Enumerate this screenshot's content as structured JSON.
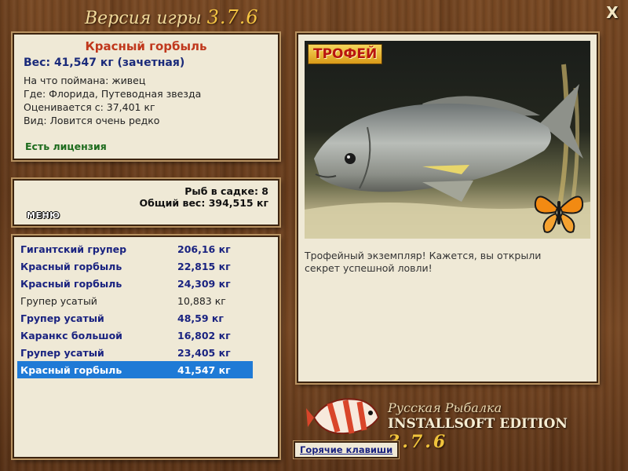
{
  "window": {
    "title_prefix": "Версия игры",
    "title_version": "3.7.6",
    "close_label": "X"
  },
  "fish_info": {
    "name": "Красный горбыль",
    "weight": "Вес: 41,547 кг (зачетная)",
    "bait": "На что поймана: живец",
    "location": "Где: Флорида, Путеводная звезда",
    "value": "Оценивается с: 37,401 кг",
    "species_note": "Вид: Ловится очень редко",
    "license": "Есть лицензия"
  },
  "stats": {
    "menu_label": "МЕНЮ",
    "fish_count": "Рыб в садке: 8",
    "total_weight": "Общий вес: 394,515 кг"
  },
  "catches": [
    {
      "name": "Гигантский групер",
      "weight": "206,16 кг",
      "style": "bold"
    },
    {
      "name": "Красный горбыль",
      "weight": "22,815 кг",
      "style": "bold"
    },
    {
      "name": "Красный горбыль",
      "weight": "24,309 кг",
      "style": "bold"
    },
    {
      "name": "Групер усатый",
      "weight": "10,883 кг",
      "style": "plain"
    },
    {
      "name": "Групер усатый",
      "weight": "48,59 кг",
      "style": "bold"
    },
    {
      "name": "Каранкс большой",
      "weight": "16,802 кг",
      "style": "bold"
    },
    {
      "name": "Групер усатый",
      "weight": "23,405 кг",
      "style": "bold"
    },
    {
      "name": "Красный горбыль",
      "weight": "41,547 кг",
      "style": "selected"
    }
  ],
  "trophy": {
    "badge": "ТРОФЕЙ",
    "caption": "Трофейный экземпляр! Кажется, вы открыли секрет успешной ловли!"
  },
  "branding": {
    "line1": "Русская Рыбалка",
    "line2": "INSTALLSOFT EDITION",
    "version": "3.7.6"
  },
  "footer": {
    "hotkeys_label": "Горячие клавиши"
  },
  "colors": {
    "selected_row": "#1f7ad6",
    "name_red": "#c0381d",
    "list_blue": "#1a2380",
    "license_green": "#1d6b1d"
  }
}
